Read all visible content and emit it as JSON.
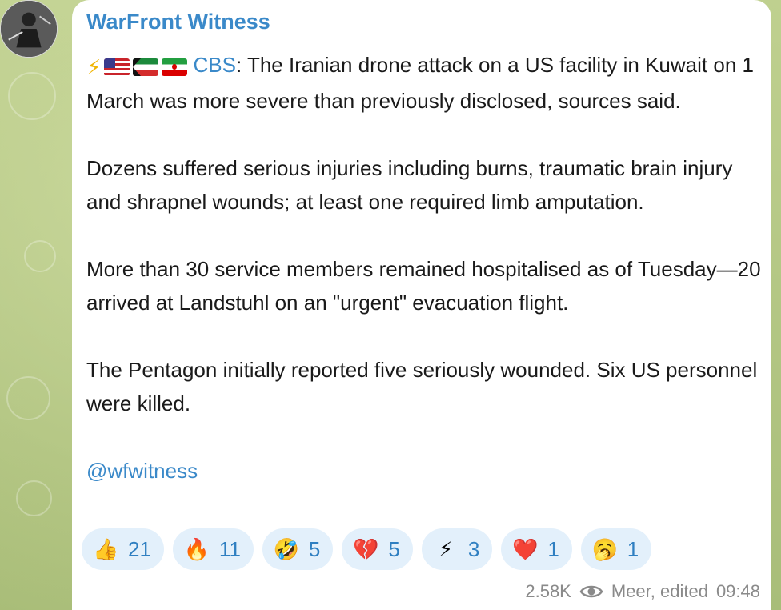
{
  "channel": {
    "name": "WarFront Witness"
  },
  "post": {
    "source_link": "CBS",
    "lead_rest": ": The Iranian drone attack on a US facility in Kuwait on 1 March was more severe than previously disclosed, sources said.",
    "p2": "Dozens suffered serious injuries including burns, traumatic brain injury and shrapnel wounds; at least one required limb amputation.",
    "p3": "More than 30 service members remained hospitalised as of Tuesday—20 arrived at Landstuhl on an \"urgent\" evacuation flight.",
    "p4": "The Pentagon initially reported five seriously wounded. Six US personnel were killed.",
    "handle": "@wfwitness"
  },
  "reactions": [
    {
      "emoji": "👍",
      "icon": "thumbs-up-icon",
      "count": "21"
    },
    {
      "emoji": "🔥",
      "icon": "fire-icon",
      "count": "11"
    },
    {
      "emoji": "🤣",
      "icon": "rofl-icon",
      "count": "5"
    },
    {
      "emoji": "💔",
      "icon": "broken-heart-icon",
      "count": "5"
    },
    {
      "emoji": "⚡",
      "icon": "lightning-icon",
      "count": "3"
    },
    {
      "emoji": "❤️",
      "icon": "heart-icon",
      "count": "1"
    },
    {
      "emoji": "🥱",
      "icon": "yawning-face-icon",
      "count": "1"
    }
  ],
  "meta": {
    "views": "2.58K",
    "status": "Meer, edited",
    "time": "09:48"
  },
  "colors": {
    "accent": "#3a89c9",
    "reaction_bg": "#e3f0fb",
    "wallpaper": "#b9c98a"
  }
}
